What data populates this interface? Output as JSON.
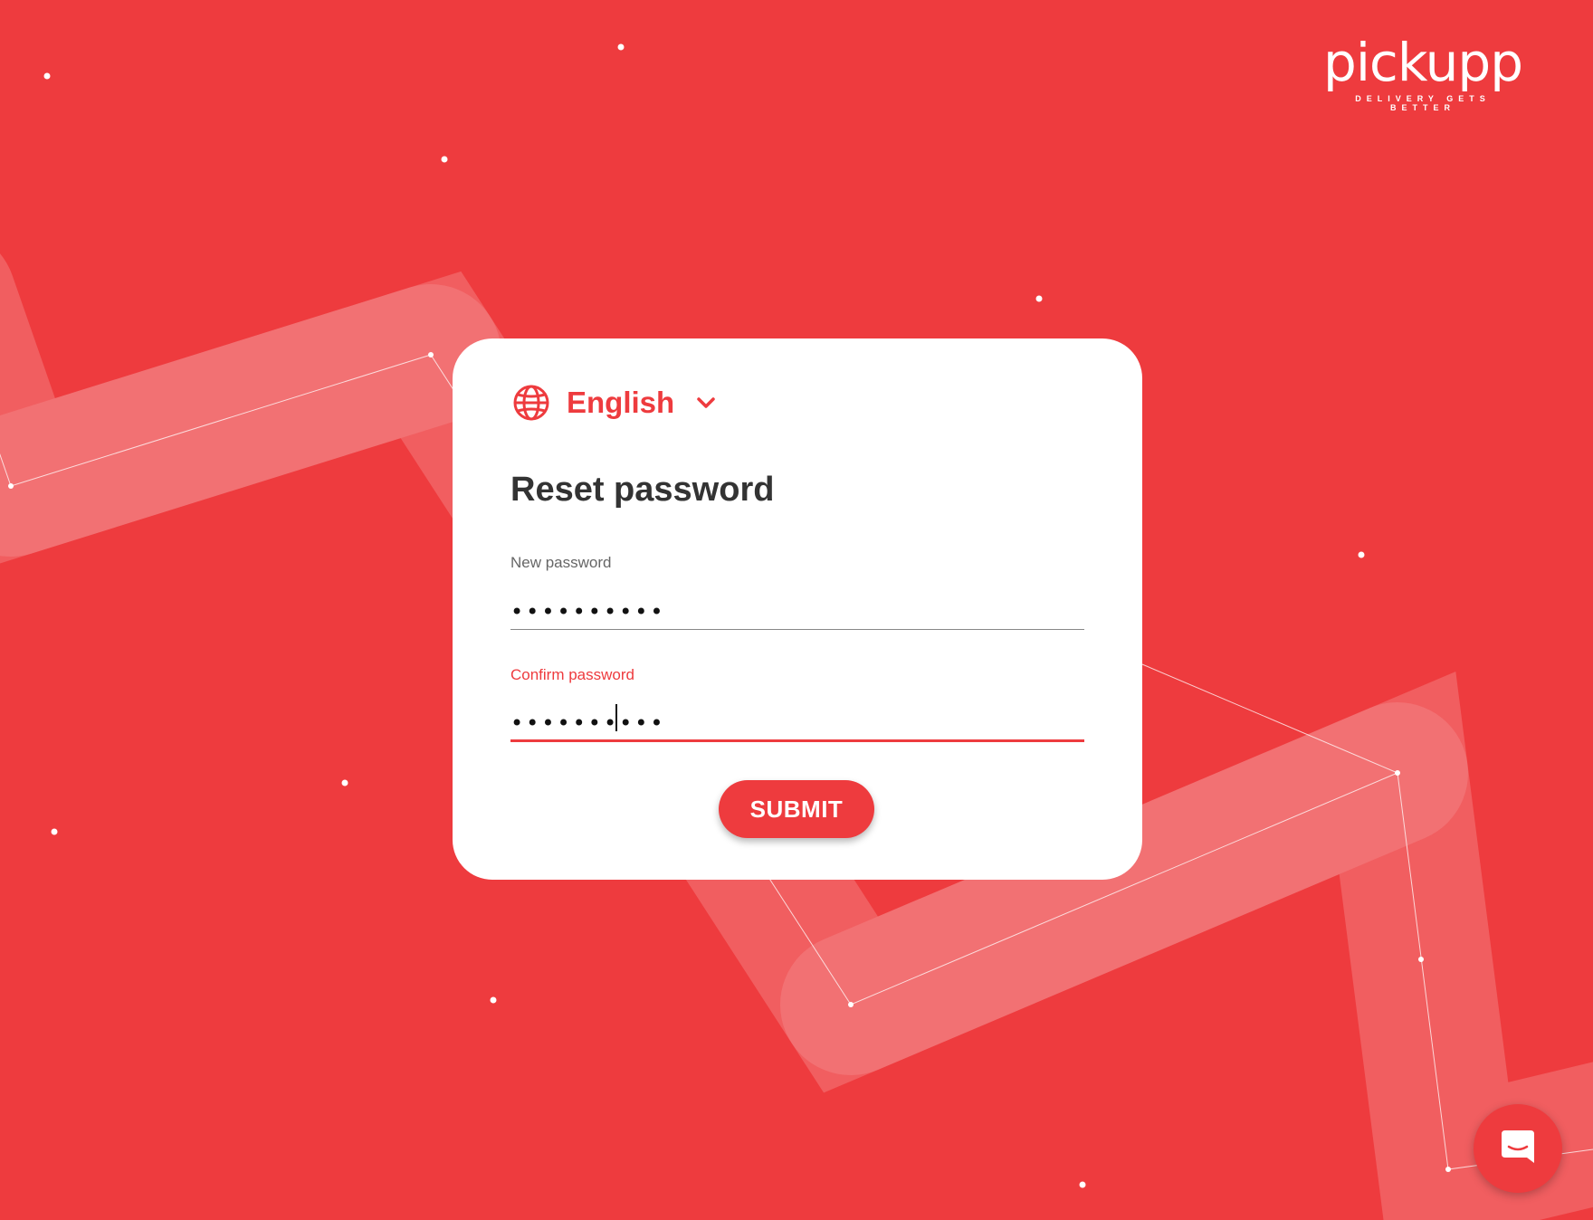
{
  "brand": {
    "name": "pickupp",
    "tagline": "DELIVERY GETS BETTER"
  },
  "language_selector": {
    "icon": "globe-icon",
    "label": "English",
    "chevron": "chevron-down-icon"
  },
  "form": {
    "title": "Reset password",
    "new_password": {
      "label": "New password",
      "value": "••••••••••"
    },
    "confirm_password": {
      "label": "Confirm password",
      "value": "••••••••••",
      "focused": true
    },
    "submit_label": "SUBMIT"
  },
  "chat": {
    "icon": "chat-icon"
  },
  "colors": {
    "brand_red": "#ee3b3e",
    "card_bg": "#ffffff",
    "title_text": "#333333"
  }
}
